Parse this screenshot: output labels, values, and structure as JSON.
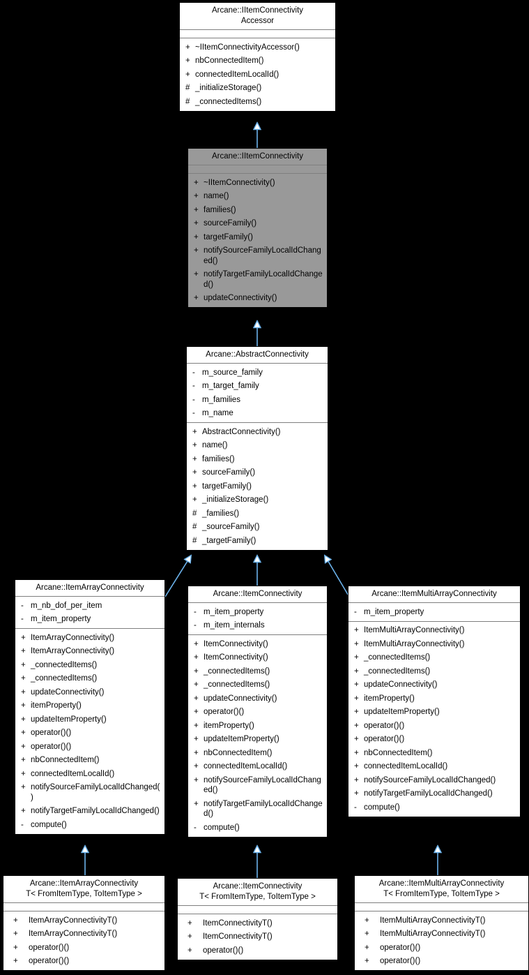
{
  "diagram": {
    "kind": "uml-class-inheritance-diagram",
    "background": "#000000",
    "edge_color": "#6cb3ec",
    "highlight_color": "#999999",
    "box_fill": "#ffffff",
    "border_color": "#000000"
  },
  "nodes": {
    "accessor": {
      "title": "Arcane::IItemConnectivity\nAccessor",
      "attributes": [],
      "methods": [
        {
          "vis": "+",
          "name": "~IItemConnectivityAccessor()"
        },
        {
          "vis": "+",
          "name": "nbConnectedItem()"
        },
        {
          "vis": "+",
          "name": "connectedItemLocalId()"
        },
        {
          "vis": "#",
          "name": "_initializeStorage()"
        },
        {
          "vis": "#",
          "name": "_connectedItems()"
        }
      ]
    },
    "iitemconnectivity": {
      "title": "Arcane::IItemConnectivity",
      "attributes": [],
      "methods": [
        {
          "vis": "+",
          "name": "~IItemConnectivity()"
        },
        {
          "vis": "+",
          "name": "name()"
        },
        {
          "vis": "+",
          "name": "families()"
        },
        {
          "vis": "+",
          "name": "sourceFamily()"
        },
        {
          "vis": "+",
          "name": "targetFamily()"
        },
        {
          "vis": "+",
          "name": "notifySourceFamilyLocalIdChanged()"
        },
        {
          "vis": "+",
          "name": "notifyTargetFamilyLocalIdChanged()"
        },
        {
          "vis": "+",
          "name": "updateConnectivity()"
        }
      ]
    },
    "abstractconnectivity": {
      "title": "Arcane::AbstractConnectivity",
      "attributes": [
        {
          "vis": "-",
          "name": "m_source_family"
        },
        {
          "vis": "-",
          "name": "m_target_family"
        },
        {
          "vis": "-",
          "name": "m_families"
        },
        {
          "vis": "-",
          "name": "m_name"
        }
      ],
      "methods": [
        {
          "vis": "+",
          "name": "AbstractConnectivity()"
        },
        {
          "vis": "+",
          "name": "name()"
        },
        {
          "vis": "+",
          "name": "families()"
        },
        {
          "vis": "+",
          "name": "sourceFamily()"
        },
        {
          "vis": "+",
          "name": "targetFamily()"
        },
        {
          "vis": "+",
          "name": "_initializeStorage()"
        },
        {
          "vis": "#",
          "name": "_families()"
        },
        {
          "vis": "#",
          "name": "_sourceFamily()"
        },
        {
          "vis": "#",
          "name": "_targetFamily()"
        }
      ]
    },
    "itemarrayconnectivity": {
      "title": "Arcane::ItemArrayConnectivity",
      "attributes": [
        {
          "vis": "-",
          "name": "m_nb_dof_per_item"
        },
        {
          "vis": "-",
          "name": "m_item_property"
        }
      ],
      "methods": [
        {
          "vis": "+",
          "name": "ItemArrayConnectivity()"
        },
        {
          "vis": "+",
          "name": "ItemArrayConnectivity()"
        },
        {
          "vis": "+",
          "name": "_connectedItems()"
        },
        {
          "vis": "+",
          "name": "_connectedItems()"
        },
        {
          "vis": "+",
          "name": "updateConnectivity()"
        },
        {
          "vis": "+",
          "name": "itemProperty()"
        },
        {
          "vis": "+",
          "name": "updateItemProperty()"
        },
        {
          "vis": "+",
          "name": "operator()()"
        },
        {
          "vis": "+",
          "name": "operator()()"
        },
        {
          "vis": "+",
          "name": "nbConnectedItem()"
        },
        {
          "vis": "+",
          "name": "connectedItemLocalId()"
        },
        {
          "vis": "+",
          "name": "notifySourceFamilyLocalIdChanged()"
        },
        {
          "vis": "+",
          "name": "notifyTargetFamilyLocalIdChanged()"
        },
        {
          "vis": "-",
          "name": "compute()"
        }
      ]
    },
    "itemconnectivity": {
      "title": "Arcane::ItemConnectivity",
      "attributes": [
        {
          "vis": "-",
          "name": "m_item_property"
        },
        {
          "vis": "-",
          "name": "m_item_internals"
        }
      ],
      "methods": [
        {
          "vis": "+",
          "name": "ItemConnectivity()"
        },
        {
          "vis": "+",
          "name": "ItemConnectivity()"
        },
        {
          "vis": "+",
          "name": "_connectedItems()"
        },
        {
          "vis": "+",
          "name": "_connectedItems()"
        },
        {
          "vis": "+",
          "name": "updateConnectivity()"
        },
        {
          "vis": "+",
          "name": "operator()()"
        },
        {
          "vis": "+",
          "name": "itemProperty()"
        },
        {
          "vis": "+",
          "name": "updateItemProperty()"
        },
        {
          "vis": "+",
          "name": "nbConnectedItem()"
        },
        {
          "vis": "+",
          "name": "connectedItemLocalId()"
        },
        {
          "vis": "+",
          "name": "notifySourceFamilyLocalIdChanged()"
        },
        {
          "vis": "+",
          "name": "notifyTargetFamilyLocalIdChanged()"
        },
        {
          "vis": "-",
          "name": "compute()"
        }
      ]
    },
    "itemmultiarrayconnectivity": {
      "title": "Arcane::ItemMultiArrayConnectivity",
      "attributes": [
        {
          "vis": "-",
          "name": "m_item_property"
        }
      ],
      "methods": [
        {
          "vis": "+",
          "name": "ItemMultiArrayConnectivity()"
        },
        {
          "vis": "+",
          "name": "ItemMultiArrayConnectivity()"
        },
        {
          "vis": "+",
          "name": "_connectedItems()"
        },
        {
          "vis": "+",
          "name": "_connectedItems()"
        },
        {
          "vis": "+",
          "name": "updateConnectivity()"
        },
        {
          "vis": "+",
          "name": "itemProperty()"
        },
        {
          "vis": "+",
          "name": "updateItemProperty()"
        },
        {
          "vis": "+",
          "name": "operator()()"
        },
        {
          "vis": "+",
          "name": "operator()()"
        },
        {
          "vis": "+",
          "name": "nbConnectedItem()"
        },
        {
          "vis": "+",
          "name": "connectedItemLocalId()"
        },
        {
          "vis": "+",
          "name": "notifySourceFamilyLocalIdChanged()"
        },
        {
          "vis": "+",
          "name": "notifyTargetFamilyLocalIdChanged()"
        },
        {
          "vis": "-",
          "name": "compute()"
        }
      ]
    },
    "itemarrayconnectivityT": {
      "title": "Arcane::ItemArrayConnectivity\nT< FromItemType, ToItemType >",
      "attributes": [],
      "methods": [
        {
          "vis": "+",
          "name": "ItemArrayConnectivityT()"
        },
        {
          "vis": "+",
          "name": "ItemArrayConnectivityT()"
        },
        {
          "vis": "+",
          "name": "operator()()"
        },
        {
          "vis": "+",
          "name": "operator()()"
        }
      ]
    },
    "itemconnectivityT": {
      "title": "Arcane::ItemConnectivity\nT< FromItemType, ToItemType >",
      "attributes": [],
      "methods": [
        {
          "vis": "+",
          "name": "ItemConnectivityT()"
        },
        {
          "vis": "+",
          "name": "ItemConnectivityT()"
        },
        {
          "vis": "+",
          "name": "operator()()"
        }
      ]
    },
    "itemmultiarrayconnectivityT": {
      "title": "Arcane::ItemMultiArrayConnectivity\nT< FromItemType, ToItemType >",
      "attributes": [],
      "methods": [
        {
          "vis": "+",
          "name": "ItemMultiArrayConnectivityT()"
        },
        {
          "vis": "+",
          "name": "ItemMultiArrayConnectivityT()"
        },
        {
          "vis": "+",
          "name": "operator()()"
        },
        {
          "vis": "+",
          "name": "operator()()"
        }
      ]
    }
  },
  "edges": [
    {
      "from": "iitemconnectivity",
      "to": "accessor",
      "type": "inheritance"
    },
    {
      "from": "abstractconnectivity",
      "to": "iitemconnectivity",
      "type": "inheritance"
    },
    {
      "from": "itemarrayconnectivity",
      "to": "abstractconnectivity",
      "type": "inheritance"
    },
    {
      "from": "itemconnectivity",
      "to": "abstractconnectivity",
      "type": "inheritance"
    },
    {
      "from": "itemmultiarrayconnectivity",
      "to": "abstractconnectivity",
      "type": "inheritance"
    },
    {
      "from": "itemarrayconnectivityT",
      "to": "itemarrayconnectivity",
      "type": "inheritance"
    },
    {
      "from": "itemconnectivityT",
      "to": "itemconnectivity",
      "type": "inheritance"
    },
    {
      "from": "itemmultiarrayconnectivityT",
      "to": "itemmultiarrayconnectivity",
      "type": "inheritance"
    }
  ]
}
